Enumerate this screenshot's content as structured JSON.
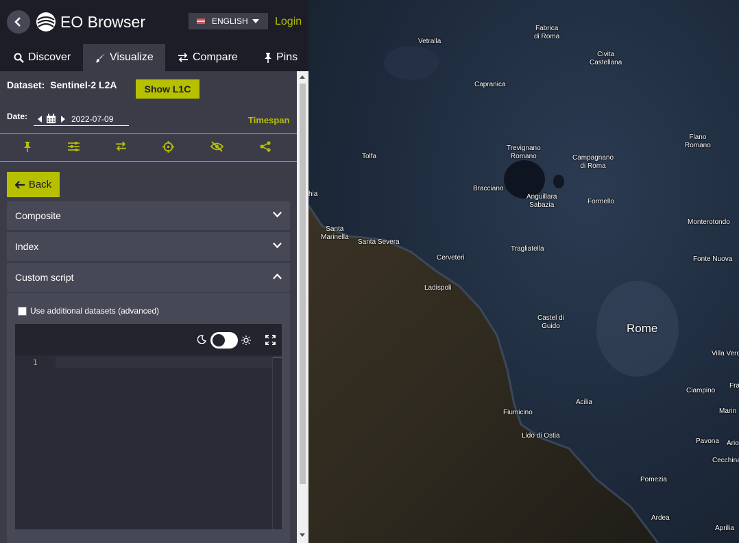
{
  "app": {
    "title": "EO Browser",
    "language": "ENGLISH",
    "login": "Login",
    "accent_color": "#b6bf00"
  },
  "tabs": [
    {
      "label": "Discover",
      "icon": "search-icon",
      "active": false
    },
    {
      "label": "Visualize",
      "icon": "paintbrush-icon",
      "active": true
    },
    {
      "label": "Compare",
      "icon": "exchange-icon",
      "active": false
    },
    {
      "label": "Pins",
      "icon": "pin-icon",
      "active": false
    }
  ],
  "dataset": {
    "label": "Dataset:",
    "value": "Sentinel-2 L2A",
    "show_button": "Show L1C"
  },
  "date": {
    "label": "Date:",
    "value": "2022-07-09",
    "timespan": "Timespan"
  },
  "toolbar_icons": [
    "pin-icon",
    "sliders-icon",
    "exchange-icon",
    "crosshair-icon",
    "eye-slash-icon",
    "share-icon"
  ],
  "back_button": "Back",
  "accordions": {
    "composite": "Composite",
    "index": "Index",
    "custom_script": "Custom script"
  },
  "custom_script": {
    "checkbox_label": "Use additional datasets (advanced)",
    "checkbox_checked": false,
    "line_number": "1",
    "dark_mode": true
  },
  "map": {
    "places": [
      {
        "name": "Fabrica\ndi Roma"
      },
      {
        "name": "Vetralla"
      },
      {
        "name": "Civita\nCastellana"
      },
      {
        "name": "Capranica"
      },
      {
        "name": "Flano\nRomano"
      },
      {
        "name": "Tolfa"
      },
      {
        "name": "Trevignano\nRomano"
      },
      {
        "name": "Campagnano\ndi Roma"
      },
      {
        "name": "hia"
      },
      {
        "name": "Bracciano"
      },
      {
        "name": "Anguillara\nSabazia"
      },
      {
        "name": "Formello"
      },
      {
        "name": "Monterotondo"
      },
      {
        "name": "Santa\nMarinella"
      },
      {
        "name": "Santa Severa"
      },
      {
        "name": "Tragliatella"
      },
      {
        "name": "Cerveteri"
      },
      {
        "name": "Fonte Nuova"
      },
      {
        "name": "Ladispoli"
      },
      {
        "name": "Castel di\nGuido"
      },
      {
        "name": "Rome"
      },
      {
        "name": "Villa Verd"
      },
      {
        "name": "Fra"
      },
      {
        "name": "Ciampino"
      },
      {
        "name": "Acilia"
      },
      {
        "name": "Fiumicino"
      },
      {
        "name": "Marin"
      },
      {
        "name": "Lido di Ostia"
      },
      {
        "name": "Pavona"
      },
      {
        "name": "Ario"
      },
      {
        "name": "Cecchina"
      },
      {
        "name": "Pomezia"
      },
      {
        "name": "Ardea"
      },
      {
        "name": "Aprilia"
      }
    ]
  }
}
